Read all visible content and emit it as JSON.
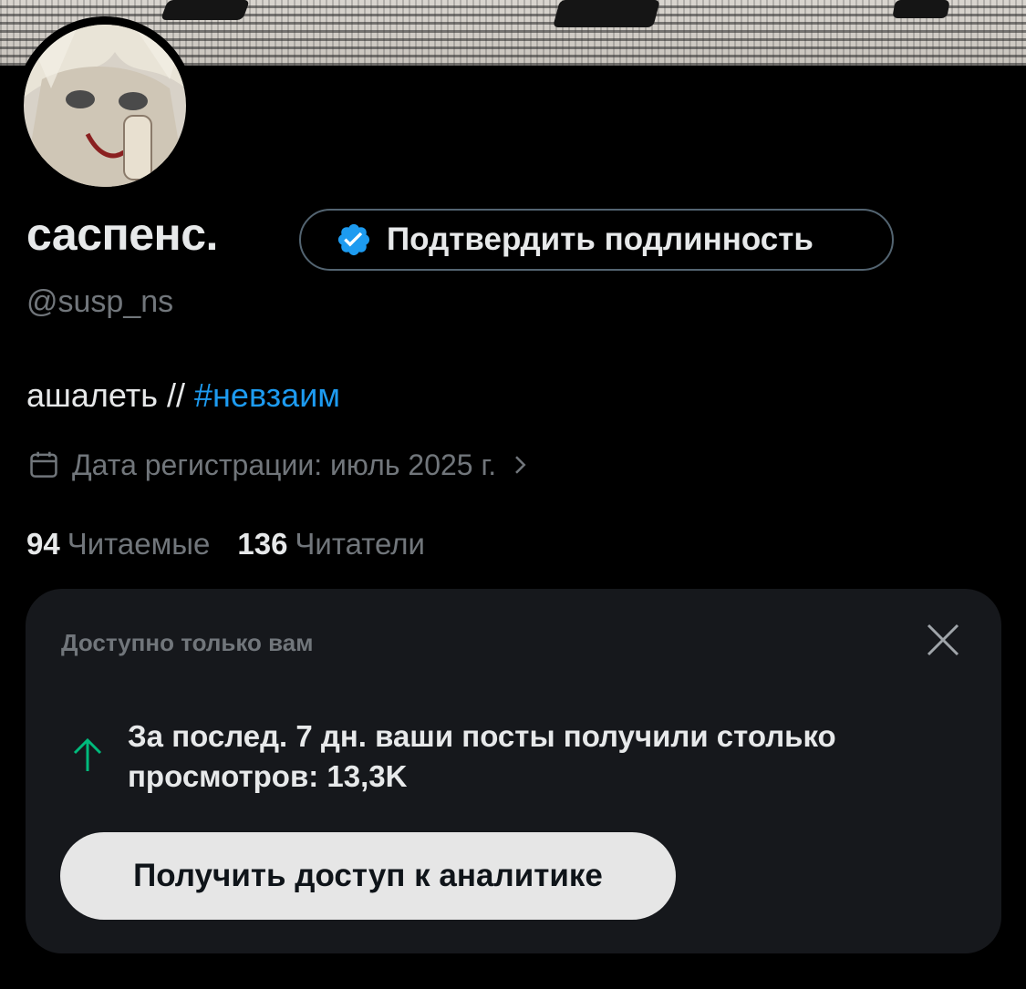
{
  "profile": {
    "display_name": "саспенс.",
    "handle": "@susp_ns",
    "verify_label": "Подтвердить подлинность",
    "bio_text": "ашалеть // ",
    "bio_hashtag": "#невзаим",
    "joined": "Дата регистрации: июль 2025 г.",
    "following_count": "94",
    "following_label": "Читаемые",
    "followers_count": "136",
    "followers_label": "Читатели"
  },
  "card": {
    "header": "Доступно только вам",
    "message": "За послед. 7 дн. ваши посты получили столько просмотров: 13,3K",
    "button_label": "Получить доступ к аналитике"
  },
  "colors": {
    "background": "#000000",
    "card_background": "#16181c",
    "accent": "#1d9bf0",
    "secondary_text": "#71767b",
    "trend_up": "#00ba7c"
  },
  "icons": {
    "verify": "verified-badge-icon",
    "joined": "calendar-icon",
    "joined_more": "chevron-right-icon",
    "close": "close-icon",
    "trend": "arrow-up-icon"
  }
}
